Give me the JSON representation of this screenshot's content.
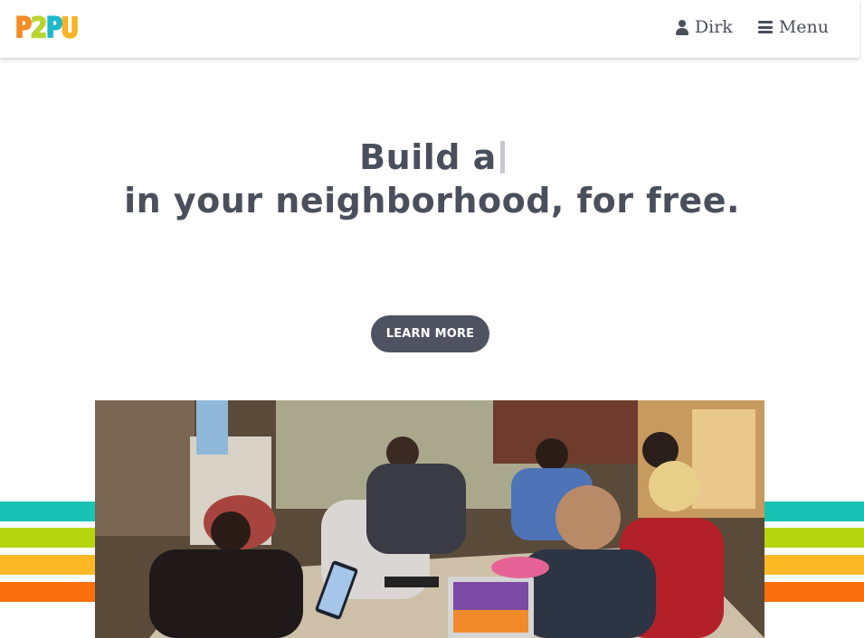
{
  "brand": {
    "logo_text": "P2PU",
    "logo_letters": [
      {
        "char": "P",
        "color": "#f48b24"
      },
      {
        "char": "2",
        "color": "#b8d433"
      },
      {
        "char": "P",
        "color": "#1fb9c9"
      },
      {
        "char": "U",
        "color": "#f7b325"
      }
    ]
  },
  "nav": {
    "user_label": "Dirk",
    "menu_label": "Menu"
  },
  "hero": {
    "line1": "Build a",
    "line2": "in your neighborhood, for free.",
    "cta_label": "LEARN MORE"
  },
  "colors": {
    "stripes": [
      "#19c3b3",
      "#b5d60f",
      "#fdb925",
      "#fb6f0e"
    ],
    "text": "#4a4f5c",
    "button": "#4f5361"
  },
  "photo": {
    "subject": "people-studying-at-table-photo"
  },
  "icons": {
    "user": "user-icon",
    "menu": "bars-icon"
  }
}
